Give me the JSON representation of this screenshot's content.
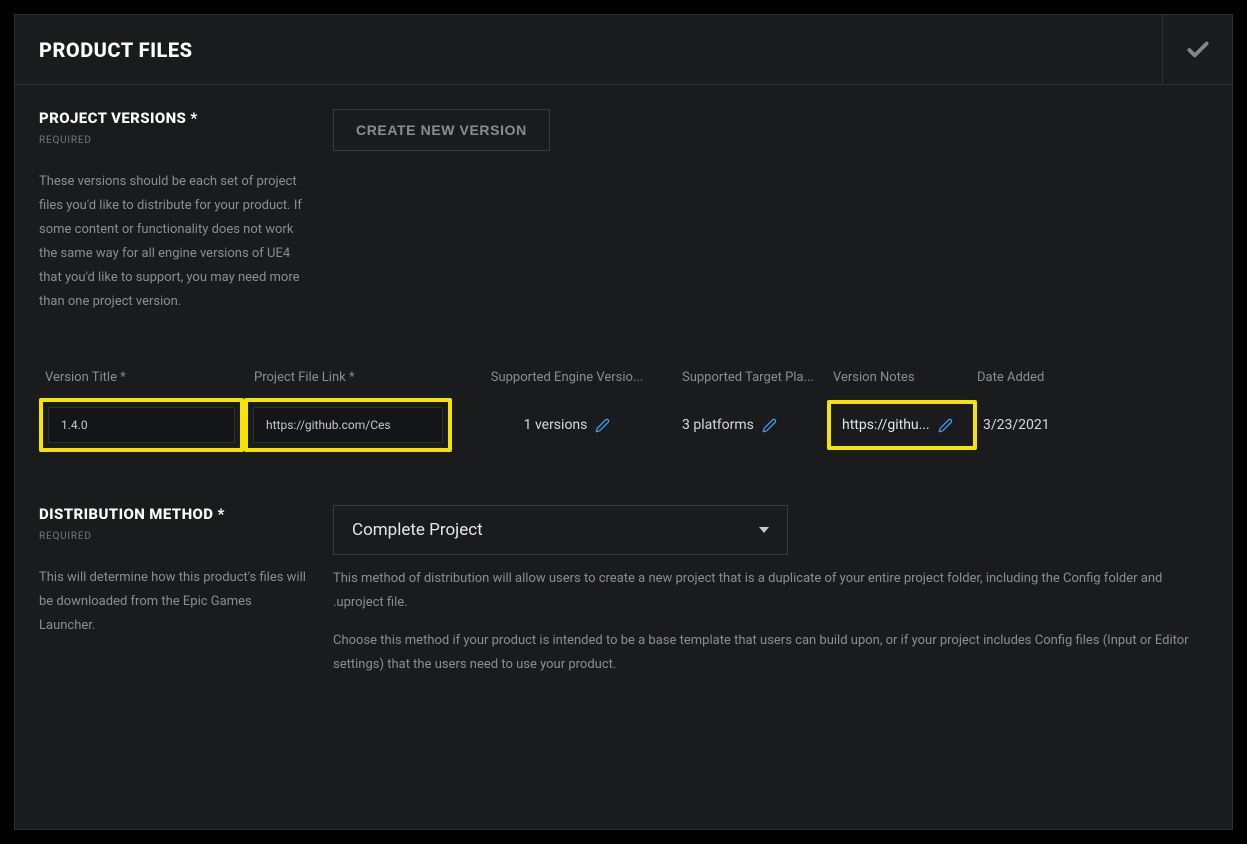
{
  "panel": {
    "title": "PRODUCT FILES"
  },
  "projectVersions": {
    "heading": "PROJECT VERSIONS *",
    "requiredTag": "REQUIRED",
    "description": "These versions should be each set of project files you'd like to distribute for your product. If some content or functionality does not work the same way for all engine versions of UE4 that you'd like to support, you may need more than one project version.",
    "createButton": "CREATE NEW VERSION",
    "columns": {
      "title": "Version Title *",
      "link": "Project File Link *",
      "engine": "Supported Engine Versio...",
      "target": "Supported Target Pla...",
      "notes": "Version Notes",
      "date": "Date Added"
    },
    "row": {
      "title": "1.4.0",
      "link": "https://github.com/Ces",
      "engine": "1 versions",
      "target": "3 platforms",
      "notes": "https://githu...",
      "date": "3/23/2021"
    }
  },
  "distribution": {
    "heading": "DISTRIBUTION METHOD *",
    "requiredTag": "REQUIRED",
    "leftDesc": "This will determine how this product's files will be downloaded from the Epic Games Launcher.",
    "selectValue": "Complete Project",
    "desc1": "This method of distribution will allow users to create a new project that is a duplicate of your entire project folder, including the Config folder and .uproject file.",
    "desc2": "Choose this method if your product is intended to be a base template that users can build upon, or if your project includes Config files (Input or Editor settings) that the users need to use your product."
  }
}
